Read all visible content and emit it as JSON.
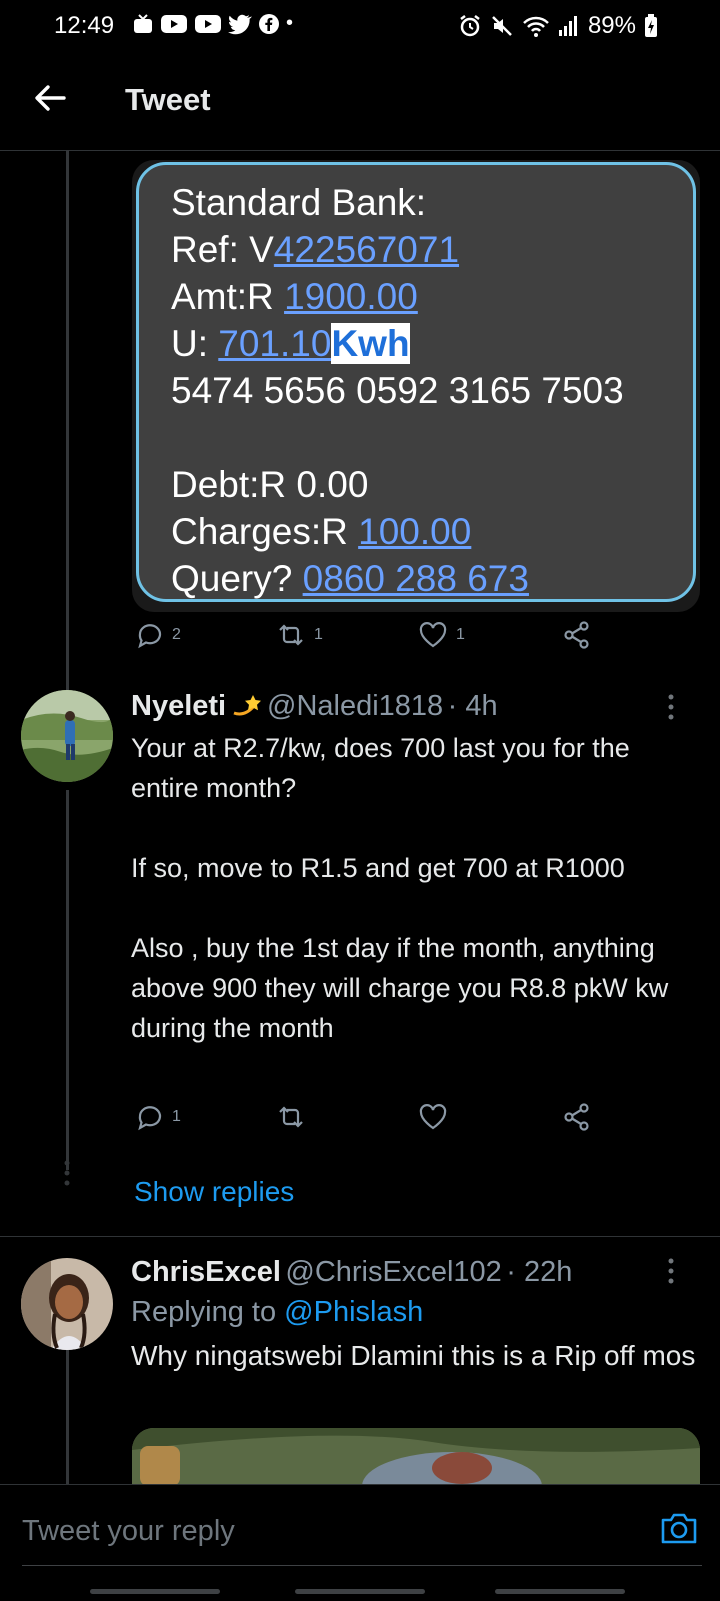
{
  "status_bar": {
    "time": "12:49",
    "battery": "89%"
  },
  "header": {
    "title": "Tweet"
  },
  "sms_image": {
    "lines": [
      {
        "prefix": "Standard Bank:",
        "link": "",
        "highlight": ""
      },
      {
        "prefix": "Ref: V",
        "link": "422567071",
        "highlight": ""
      },
      {
        "prefix": "Amt:R ",
        "link": "1900.00",
        "highlight": ""
      },
      {
        "prefix": "U: ",
        "link": "701.10",
        "highlight": "Kwh"
      },
      {
        "prefix": "5474 5656 0592 3165 7503",
        "link": "",
        "highlight": ""
      },
      {
        "prefix": "",
        "link": "",
        "highlight": ""
      },
      {
        "prefix": "Debt:R 0.00",
        "link": "",
        "highlight": ""
      },
      {
        "prefix": "Charges:R ",
        "link": "100.00",
        "highlight": ""
      },
      {
        "prefix": "Query? ",
        "link": "0860 288 673",
        "highlight": ""
      }
    ]
  },
  "main_actions": {
    "replies": "2",
    "retweets": "1",
    "likes": "1"
  },
  "reply1": {
    "name": "Nyeleti",
    "handle": "@Naledi1818",
    "time": "· 4h",
    "paragraphs": [
      "Your at R2.7/kw,  does 700 last you for the entire month?",
      "If so, move to R1.5 and get 700 at R1000",
      "Also , buy the 1st day if the month, anything above 900 they will charge you R8.8 pkW kw during the month"
    ],
    "replies": "1",
    "show_replies": "Show replies"
  },
  "reply2": {
    "name": "ChrisExcel",
    "handle": "@ChrisExcel102",
    "time": "· 22h",
    "replying_prefix": "Replying to ",
    "replying_handle": "@Phislash",
    "text": "Why ningatswebi Dlamini this is a Rip off mos"
  },
  "reply_bar": {
    "placeholder": "Tweet your reply"
  },
  "colors": {
    "accent": "#1d9bf0",
    "background": "#000000",
    "secondary_text": "#8b98a5"
  }
}
